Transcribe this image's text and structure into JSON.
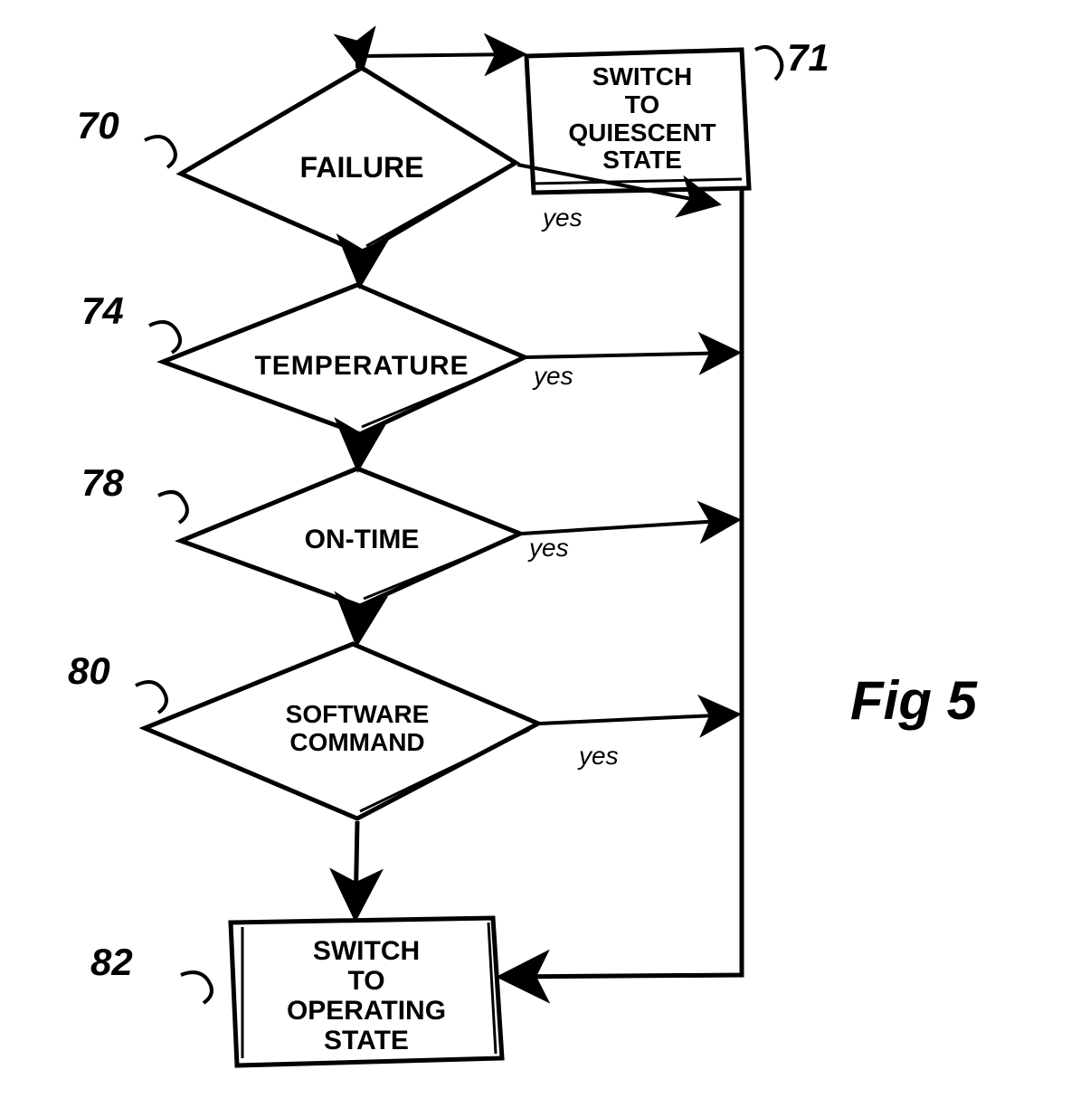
{
  "chart_data": {
    "type": "flowchart",
    "title": "Fig 5",
    "nodes": [
      {
        "id": "70",
        "shape": "decision",
        "text": "FAILURE",
        "ref": "70"
      },
      {
        "id": "71",
        "shape": "process",
        "text": "SWITCH TO QUIESCENT STATE",
        "ref": "71"
      },
      {
        "id": "74",
        "shape": "decision",
        "text": "TEMPERATURE",
        "ref": "74"
      },
      {
        "id": "78",
        "shape": "decision",
        "text": "ON-TIME",
        "ref": "78"
      },
      {
        "id": "80",
        "shape": "decision",
        "text": "SOFTWARE COMMAND",
        "ref": "80"
      },
      {
        "id": "82",
        "shape": "process",
        "text": "SWITCH TO OPERATING STATE",
        "ref": "82"
      }
    ],
    "edges": [
      {
        "from": "70",
        "to": "74",
        "label": ""
      },
      {
        "from": "70",
        "to": "71",
        "label": "yes"
      },
      {
        "from": "74",
        "to": "78",
        "label": ""
      },
      {
        "from": "74",
        "to": "71",
        "label": "yes"
      },
      {
        "from": "78",
        "to": "80",
        "label": ""
      },
      {
        "from": "78",
        "to": "71",
        "label": "yes"
      },
      {
        "from": "80",
        "to": "82",
        "label": ""
      },
      {
        "from": "80",
        "to": "71",
        "label": "yes"
      },
      {
        "from": "71",
        "to": "82",
        "label": ""
      }
    ]
  },
  "labels": {
    "ref70": "70",
    "ref71": "71",
    "ref74": "74",
    "ref78": "78",
    "ref80": "80",
    "ref82": "82",
    "node70": "FAILURE",
    "node71": "SWITCH\nTO\nQUIESCENT\nSTATE",
    "node74": "TEMPERATURE",
    "node78": "ON-TIME",
    "node80": "SOFTWARE\nCOMMAND",
    "node82": "SWITCH\nTO\nOPERATING\nSTATE",
    "yes1": "yes",
    "yes2": "yes",
    "yes3": "yes",
    "yes4": "yes",
    "fig": "Fig 5"
  }
}
